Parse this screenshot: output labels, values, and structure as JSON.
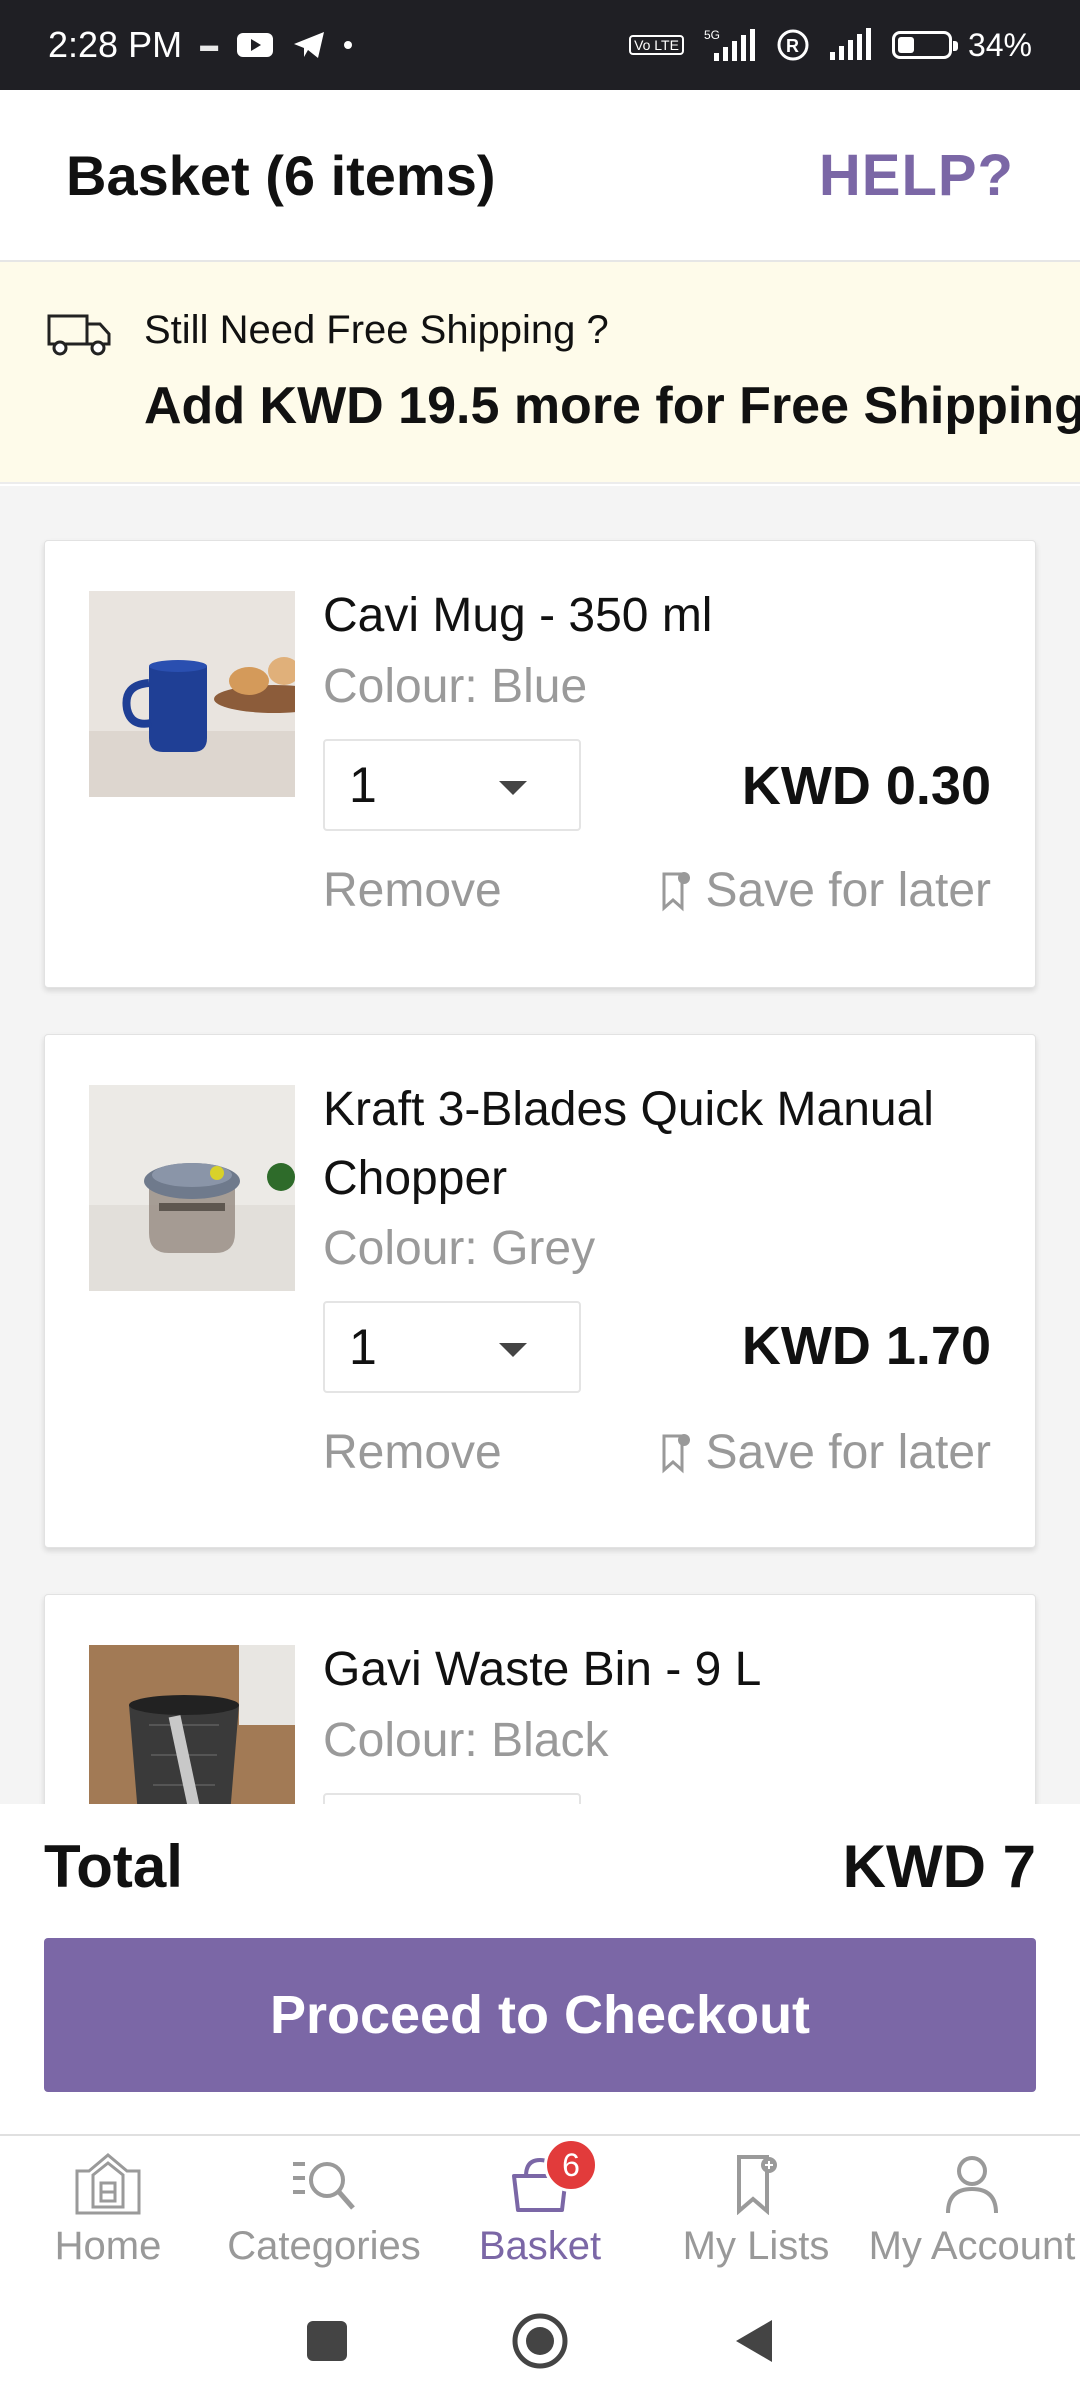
{
  "status_bar": {
    "time": "2:28 PM",
    "network_small": "5G",
    "volte": "Vo LTE",
    "battery_percent": "34%",
    "battery_level": 0.34
  },
  "header": {
    "title": "Basket (6 items)",
    "help_label": "HELP?"
  },
  "shipping_banner": {
    "line1": "Still Need Free Shipping ?",
    "line2": "Add KWD 19.5 more for Free Shipping"
  },
  "items": [
    {
      "name": "Cavi Mug - 350 ml",
      "colour": "Colour: Blue",
      "qty": "1",
      "price": "KWD 0.30",
      "remove": "Remove",
      "save_later": "Save for later"
    },
    {
      "name": "Kraft 3-Blades Quick Manual Chopper",
      "colour": "Colour: Grey",
      "qty": "1",
      "price": "KWD 1.70",
      "remove": "Remove",
      "save_later": "Save for later"
    },
    {
      "name": "Gavi Waste Bin - 9 L",
      "colour": "Colour: Black"
    }
  ],
  "total": {
    "label": "Total",
    "value": "KWD 7"
  },
  "checkout_label": "Proceed to Checkout",
  "bottom_nav": {
    "items": [
      {
        "label": "Home",
        "icon": "home-logo-icon"
      },
      {
        "label": "Categories",
        "icon": "categories-search-icon"
      },
      {
        "label": "Basket",
        "icon": "basket-icon",
        "badge": "6"
      },
      {
        "label": "My Lists",
        "icon": "bookmark-icon"
      },
      {
        "label": "My Account",
        "icon": "account-icon"
      }
    ],
    "active": "Basket"
  },
  "colors": {
    "accent": "#7b67a6",
    "banner_bg": "#fefbea",
    "badge": "#e23b3b"
  }
}
